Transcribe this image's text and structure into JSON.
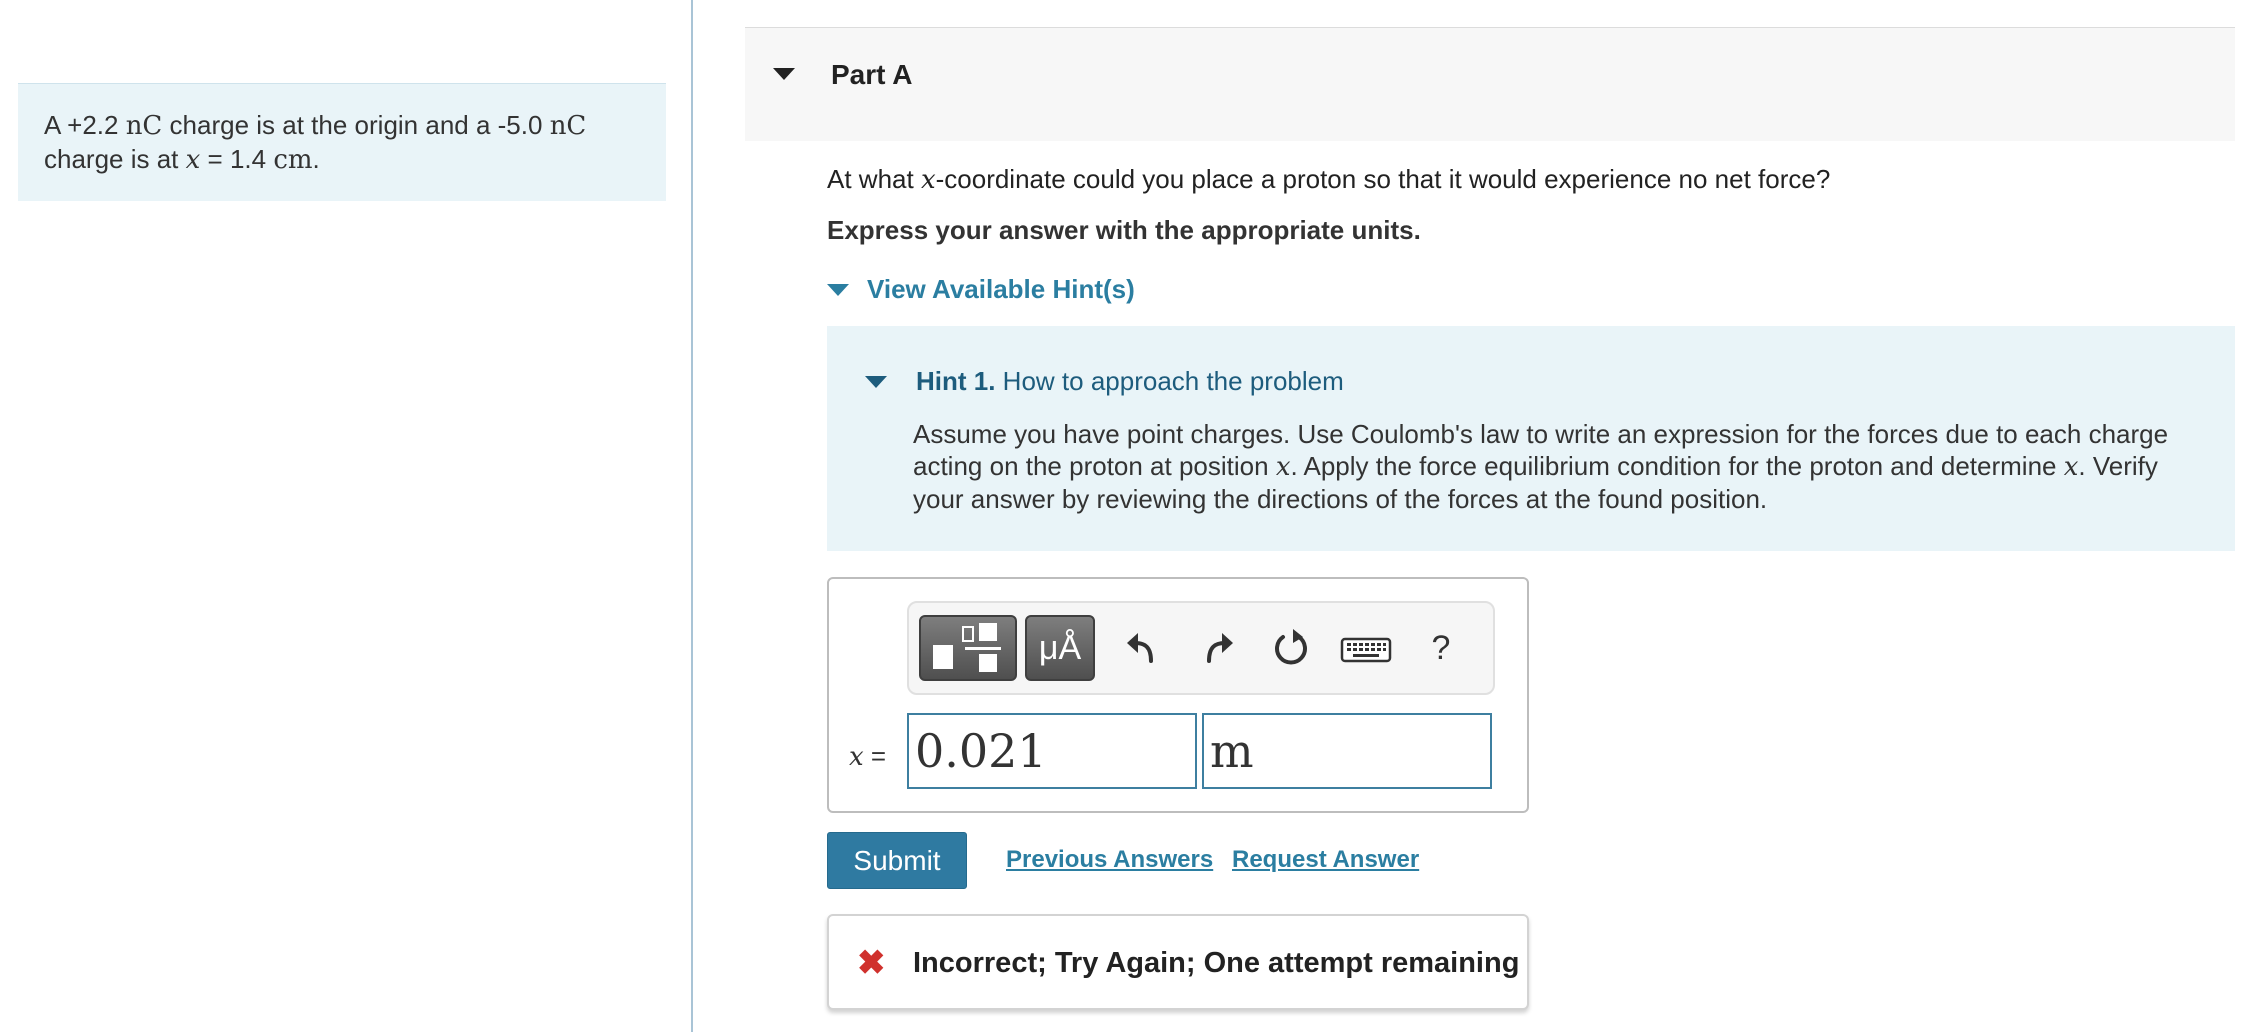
{
  "problem": {
    "prefix": "A +2.2 ",
    "charge1_unit": "nC",
    "middle": " charge is at the origin and a -5.0 ",
    "charge2_unit": "nC",
    "line2_prefix": "charge is at ",
    "position_var": "x",
    "position_eq": " = 1.4 ",
    "position_unit": "cm",
    "line2_end": "."
  },
  "part": {
    "title": "Part A"
  },
  "question": {
    "prefix": "At what ",
    "var": "x",
    "suffix": "-coordinate could you place a proton so that it would experience no net force?"
  },
  "instructions": "Express your answer with the appropriate units.",
  "hints": {
    "toggle_label": "View Available Hint(s)",
    "hint1": {
      "label": "Hint 1.",
      "title": " How to approach the problem",
      "body_part1": "Assume you have point charges. Use Coulomb's law to write an expression for the forces due to each charge acting on the proton at position ",
      "var1": "x",
      "body_part2": ". Apply the force equilibrium condition for the proton and determine ",
      "var2": "x",
      "body_part3": ". Verify your answer by reviewing the directions of the forces at the found position."
    }
  },
  "answer": {
    "toolbar": {
      "templates_icon": "templates-icon",
      "units_label": "μÅ",
      "undo_icon": "undo-icon",
      "redo_icon": "redo-icon",
      "reset_icon": "reset-icon",
      "keyboard_icon": "keyboard-icon",
      "help_label": "?"
    },
    "variable": "x",
    "equals": " =",
    "value": "0.021",
    "unit": "m"
  },
  "actions": {
    "submit_label": "Submit",
    "previous_answers_label": "Previous Answers",
    "request_answer_label": "Request Answer"
  },
  "feedback": {
    "icon": "✖",
    "text": "Incorrect; Try Again; One attempt remaining"
  },
  "colors": {
    "accent": "#2b7ea1",
    "hint_bg": "#e9f4f8",
    "error": "#d0312d",
    "submit_bg": "#2f7aa1"
  }
}
